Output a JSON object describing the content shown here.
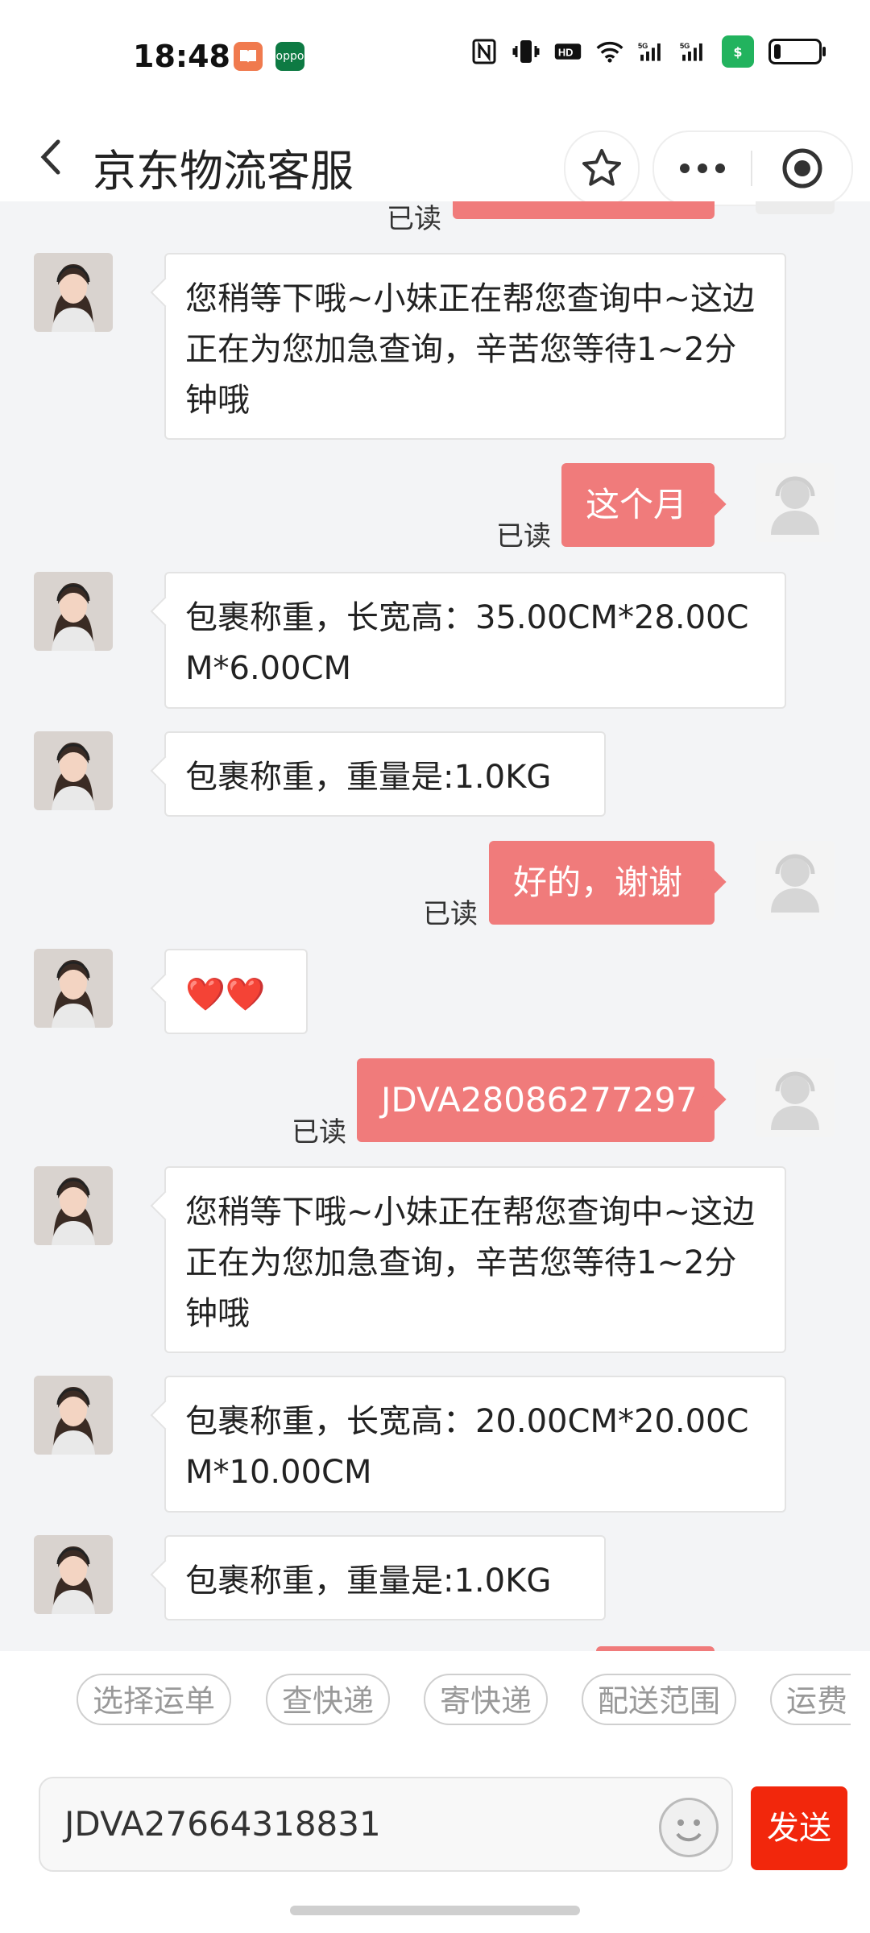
{
  "status_bar": {
    "time": "18:48",
    "icons": [
      "books-app-icon",
      "oppo-app-icon",
      "nfc-icon",
      "vibrate-icon",
      "hd-icon",
      "wifi-icon",
      "signal-5g-icon",
      "signal-5g-icon",
      "security-shield-icon",
      "battery-icon"
    ],
    "hd_text": "HD",
    "shield_text": "$",
    "battery_percent": 15
  },
  "nav": {
    "title": "京东物流客服",
    "back_icon": "chevron-left-icon",
    "favorite_icon": "star-icon",
    "more_icon": "more-dots-icon",
    "close_icon": "target-circle-icon"
  },
  "chat": {
    "read_label": "已读",
    "messages": [
      {
        "from": "agent",
        "text": "您稍等下哦~小妹正在帮您查询中~这边正在为您加急查询，辛苦您等待1~2分钟哦"
      },
      {
        "from": "user",
        "text": "这个月",
        "read": "已读"
      },
      {
        "from": "agent",
        "text": "包裹称重，长宽高：35.00CM*28.00CM*6.00CM"
      },
      {
        "from": "agent",
        "text": "包裹称重，重量是:1.0KG"
      },
      {
        "from": "user",
        "text": "好的，谢谢",
        "read": "已读"
      },
      {
        "from": "agent",
        "text": "❤️❤️"
      },
      {
        "from": "user",
        "text": "JDVA28086277297",
        "read": "已读"
      },
      {
        "from": "agent",
        "text": "您稍等下哦~小妹正在帮您查询中~这边正在为您加急查询，辛苦您等待1~2分钟哦"
      },
      {
        "from": "agent",
        "text": "包裹称重，长宽高：20.00CM*20.00CM*10.00CM"
      },
      {
        "from": "agent",
        "text": "包裹称重，重量是:1.0KG"
      }
    ]
  },
  "quick_replies": [
    "选择运单",
    "查快递",
    "寄快递",
    "配送范围",
    "运费"
  ],
  "input": {
    "value": "JDVA27664318831",
    "emoji_icon": "smiley-icon",
    "send_label": "发送"
  },
  "colors": {
    "user_bubble": "#f07b7b",
    "send_button": "#f2270c",
    "chat_bg": "#f3f4f6"
  }
}
